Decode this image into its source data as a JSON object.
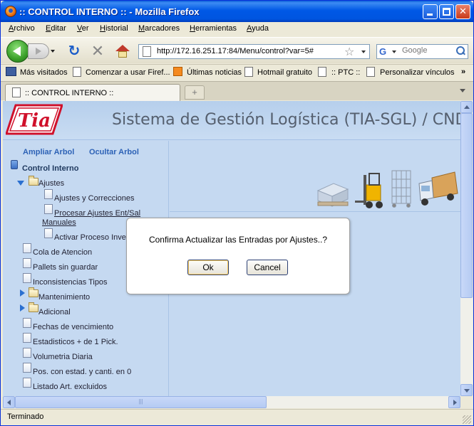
{
  "window": {
    "title": ":: CONTROL INTERNO :: - Mozilla Firefox"
  },
  "menu": [
    "Archivo",
    "Editar",
    "Ver",
    "Historial",
    "Marcadores",
    "Herramientas",
    "Ayuda"
  ],
  "nav": {
    "url": "http://172.16.251.17:84/Menu/control?var=5#",
    "search_placeholder": "Google"
  },
  "bookmarks": [
    "Más visitados",
    "Comenzar a usar Firef...",
    "Últimas noticias",
    "Hotmail gratuito",
    ":: PTC ::",
    "Personalizar vínculos",
    "»"
  ],
  "tabs": {
    "active": ":: CONTROL INTERNO ::",
    "new_tab": "+"
  },
  "page": {
    "logo_text": "Tia",
    "title": "Sistema de Gestión Logística (TIA-SGL) / CND",
    "tree_links": {
      "expand": "Ampliar Arbol",
      "hide": "Ocultar Arbol"
    },
    "tree": {
      "root": "Control Interno",
      "ajustes": "Ajustes",
      "ajustes_children": [
        "Ajustes y Correcciones",
        "Procesar Ajustes Ent/Sal",
        "Manuales",
        "Activar Proceso Inve"
      ],
      "items": [
        "Cola de Atencion",
        "Pallets sin guardar",
        "Inconsistencias Tipos",
        "Mantenimiento",
        "Adicional",
        "Fechas de vencimiento",
        "Estadisticos + de 1 Pick.",
        "Volumetria Diaria",
        "Pos. con estad. y canti. en 0",
        "Listado Art. excluidos"
      ]
    }
  },
  "dialog": {
    "message": "Confirma Actualizar las Entradas por Ajustes..?",
    "ok": "Ok",
    "cancel": "Cancel"
  },
  "scroll": {
    "thumb_grip": "|||"
  },
  "status": {
    "text": "Terminado"
  }
}
